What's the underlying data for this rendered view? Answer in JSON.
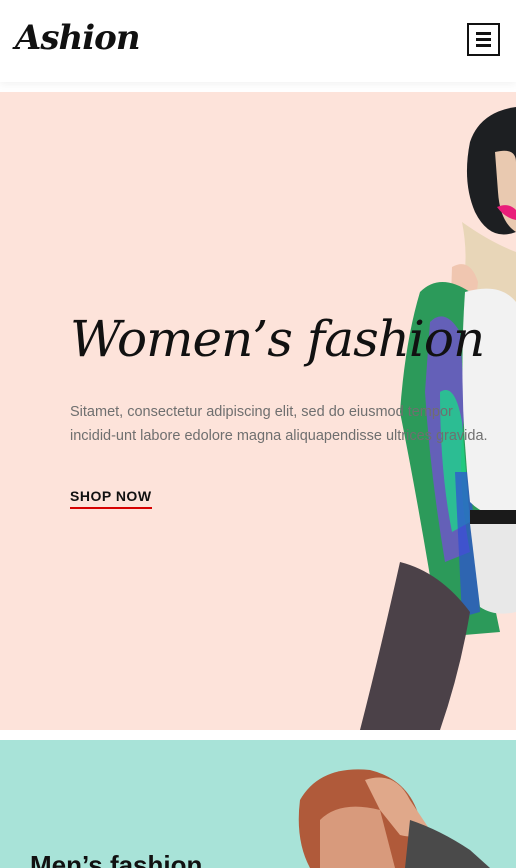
{
  "header": {
    "logo_text": "Ashion",
    "menu_icon": "hamburger-menu-icon"
  },
  "hero": {
    "title": "Women’s fashion",
    "description": "Sitamet, consectetur adipiscing elit, sed do eiusmod tempor incidid-unt labore edolore magna aliquapendisse ultrices gravida.",
    "cta_label": "SHOP NOW",
    "background_color": "#fde3da",
    "cta_underline_color": "#d60000"
  },
  "mens_banner": {
    "title": "Men’s fashion",
    "background_color": "#a8e3d8"
  }
}
